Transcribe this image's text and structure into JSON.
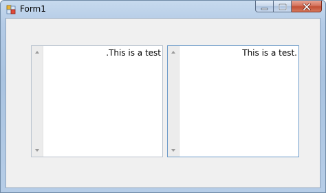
{
  "window": {
    "title": "Form1",
    "controls": {
      "minimize_icon": "minimize-icon",
      "maximize_icon": "maximize-icon",
      "close_label": "x"
    }
  },
  "textboxes": [
    {
      "text": ".This is a test",
      "direction": "rtl-rendering"
    },
    {
      "text": "This is a test.",
      "direction": "ltr-rendering"
    }
  ],
  "colors": {
    "titlebar": "#b4cbe6",
    "client_background": "#f0f0f0",
    "close_button": "#c24f35",
    "focused_border": "#6c9bc9"
  }
}
